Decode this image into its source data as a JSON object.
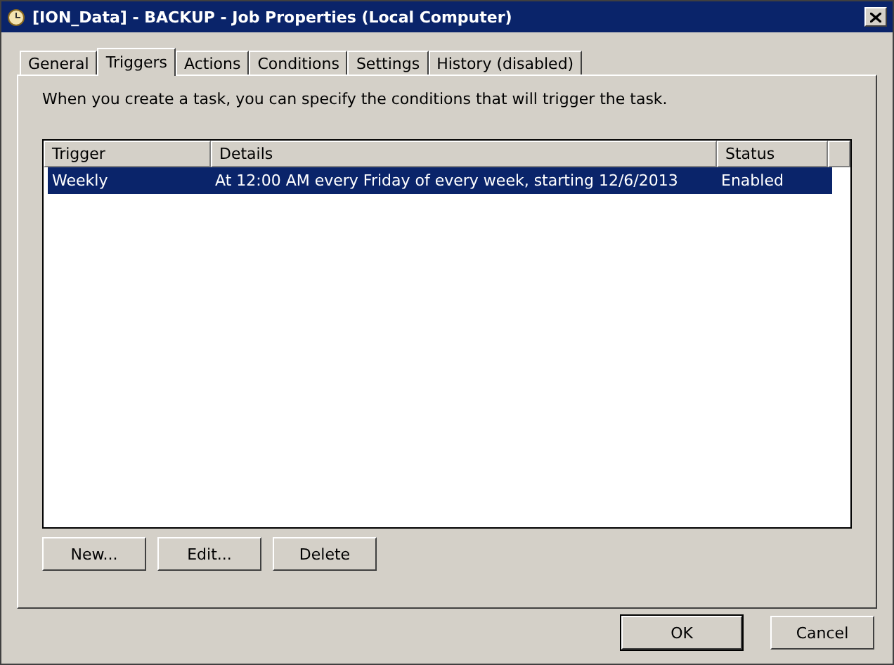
{
  "window": {
    "title": "[ION_Data] - BACKUP - Job Properties (Local Computer)"
  },
  "tabs": [
    {
      "label": "General",
      "selected": false
    },
    {
      "label": "Triggers",
      "selected": true
    },
    {
      "label": "Actions",
      "selected": false
    },
    {
      "label": "Conditions",
      "selected": false
    },
    {
      "label": "Settings",
      "selected": false
    },
    {
      "label": "History (disabled)",
      "selected": false
    }
  ],
  "description": "When you create a task, you can specify the conditions that will trigger the task.",
  "table": {
    "columns": [
      "Trigger",
      "Details",
      "Status"
    ],
    "rows": [
      {
        "cells": [
          "Weekly",
          "At 12:00 AM every Friday of every week, starting 12/6/2013",
          "Enabled"
        ],
        "selected": true
      }
    ]
  },
  "list_buttons": [
    "New...",
    "Edit...",
    "Delete"
  ],
  "dialog_buttons": [
    {
      "label": "OK",
      "default": true
    },
    {
      "label": "Cancel",
      "default": false
    }
  ]
}
